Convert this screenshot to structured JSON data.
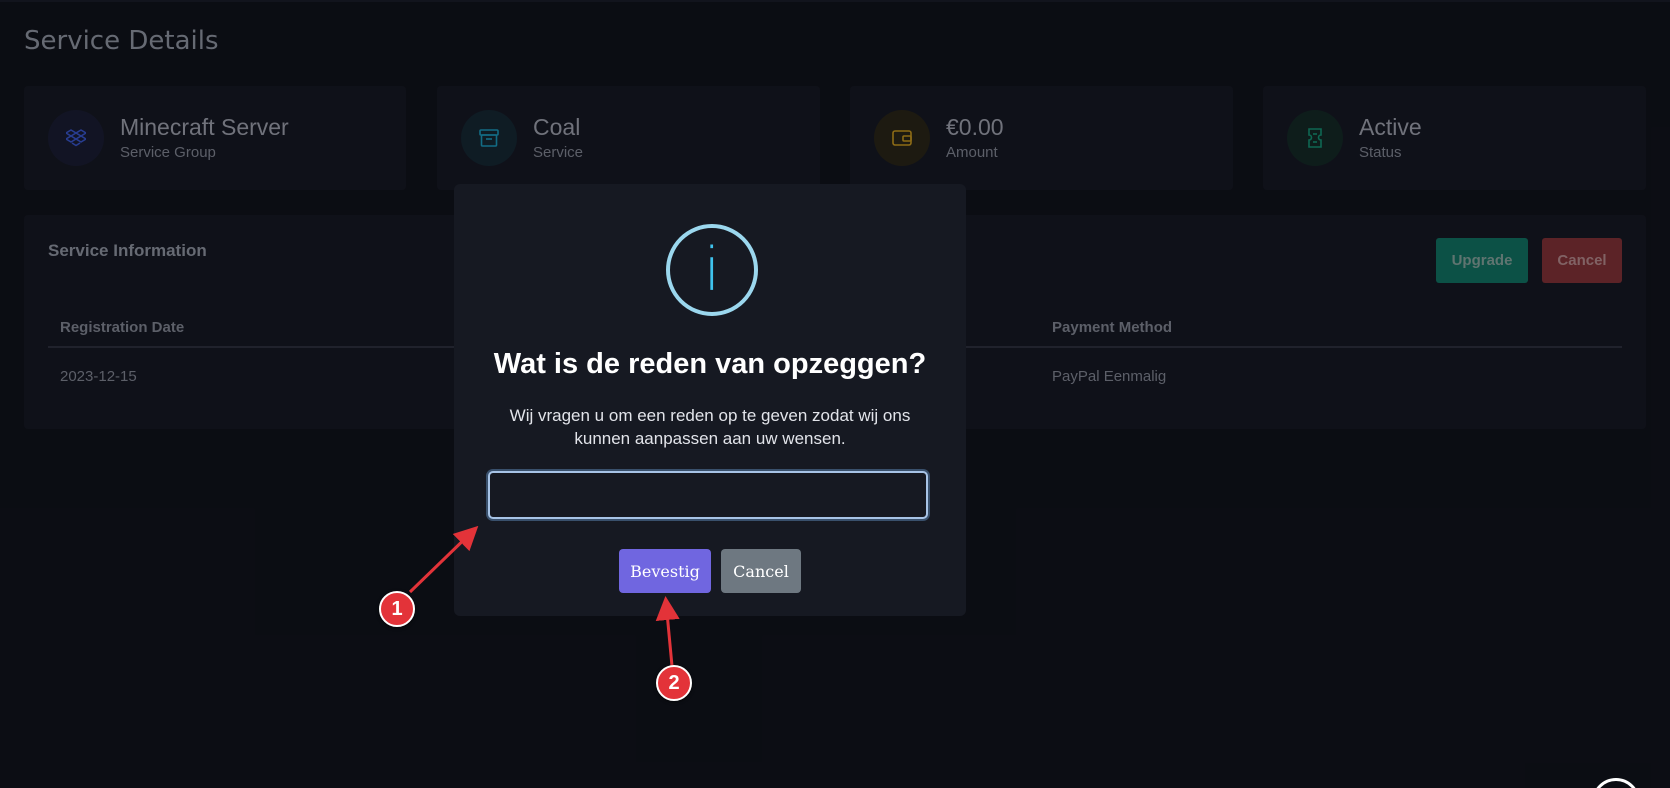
{
  "page": {
    "title": "Service Details"
  },
  "cards": [
    {
      "title": "Minecraft Server",
      "subtitle": "Service Group",
      "icon": "dropbox-icon",
      "color": "#3b5bdb"
    },
    {
      "title": "Coal",
      "subtitle": "Service",
      "icon": "archive-icon",
      "color": "#1aa3c8"
    },
    {
      "title": "€0.00",
      "subtitle": "Amount",
      "icon": "wallet-icon",
      "color": "#d6a21e"
    },
    {
      "title": "Active",
      "subtitle": "Status",
      "icon": "ticket-icon",
      "color": "#139c7a"
    }
  ],
  "info": {
    "title": "Service Information",
    "upgrade_label": "Upgrade",
    "cancel_label": "Cancel",
    "columns": [
      "Registration Date",
      "Payment Method"
    ],
    "row": [
      "2023-12-15",
      "PayPal Eenmalig"
    ]
  },
  "modal": {
    "icon": "info-icon",
    "icon_glyph": "i",
    "title": "Wat is de reden van opzeggen?",
    "text": "Wij vragen u om een reden op te geven zodat wij ons kunnen aanpassen aan uw wensen.",
    "input_value": "",
    "confirm_label": "Bevestig",
    "cancel_label": "Cancel"
  },
  "annotations": [
    "1",
    "2"
  ],
  "colors": {
    "background": "#0f111a",
    "panel": "#151823",
    "modal": "#161922",
    "confirm": "#7066e0",
    "cancel_modal": "#6e7881",
    "upgrade": "#107a67",
    "cancel_top": "#8a3338",
    "marker": "#e33339"
  }
}
